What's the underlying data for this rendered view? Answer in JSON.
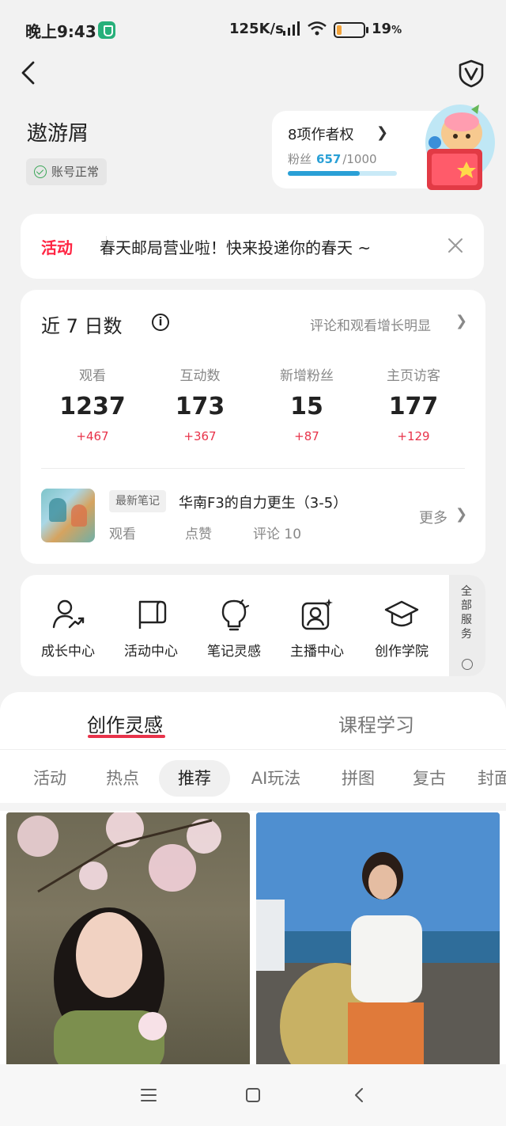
{
  "status_bar": {
    "time": "晚上9:43",
    "net_speed": "125K/s",
    "battery_percent": "19",
    "battery_unit": "%",
    "battery_level": 0.19
  },
  "nav": {
    "back_icon": "chevron-left-icon",
    "right_icon": "shield-v-icon"
  },
  "profile": {
    "username": "遨游屑",
    "account_status": "账号正常",
    "rights_title": "8项作者权",
    "fans_label": "粉丝",
    "fans_current": "657",
    "fans_target": "/1000",
    "fans_progress": 0.657
  },
  "banner": {
    "tag": "活动",
    "text": "春天邮局营业啦！快来投递你的春天 ~"
  },
  "stats": {
    "title": "近 7 日数",
    "hint": "评论和观看增长明显",
    "metrics": [
      {
        "label": "观看",
        "value": "1237",
        "delta": "+467"
      },
      {
        "label": "互动数",
        "value": "173",
        "delta": "+367"
      },
      {
        "label": "新增粉丝",
        "value": "15",
        "delta": "+87"
      },
      {
        "label": "主页访客",
        "value": "177",
        "delta": "+129"
      }
    ],
    "latest_note": {
      "tag": "最新笔记",
      "title": "华南F3的自力更生（3-5）",
      "views_label": "观看",
      "likes_label": "点赞",
      "comments_label": "评论 10",
      "more": "更多"
    }
  },
  "tools": {
    "items": [
      {
        "label": "成长中心",
        "icon": "growth-icon"
      },
      {
        "label": "活动中心",
        "icon": "flag-icon"
      },
      {
        "label": "笔记灵感",
        "icon": "bulb-icon"
      },
      {
        "label": "主播中心",
        "icon": "streamer-icon"
      },
      {
        "label": "创作学院",
        "icon": "graduation-cap-icon"
      }
    ],
    "all_services": "全部服务"
  },
  "content": {
    "tabs": [
      "创作灵感",
      "课程学习"
    ],
    "chips": [
      "活动",
      "热点",
      "推荐",
      "AI玩法",
      "拼图",
      "复古",
      "封面"
    ]
  }
}
